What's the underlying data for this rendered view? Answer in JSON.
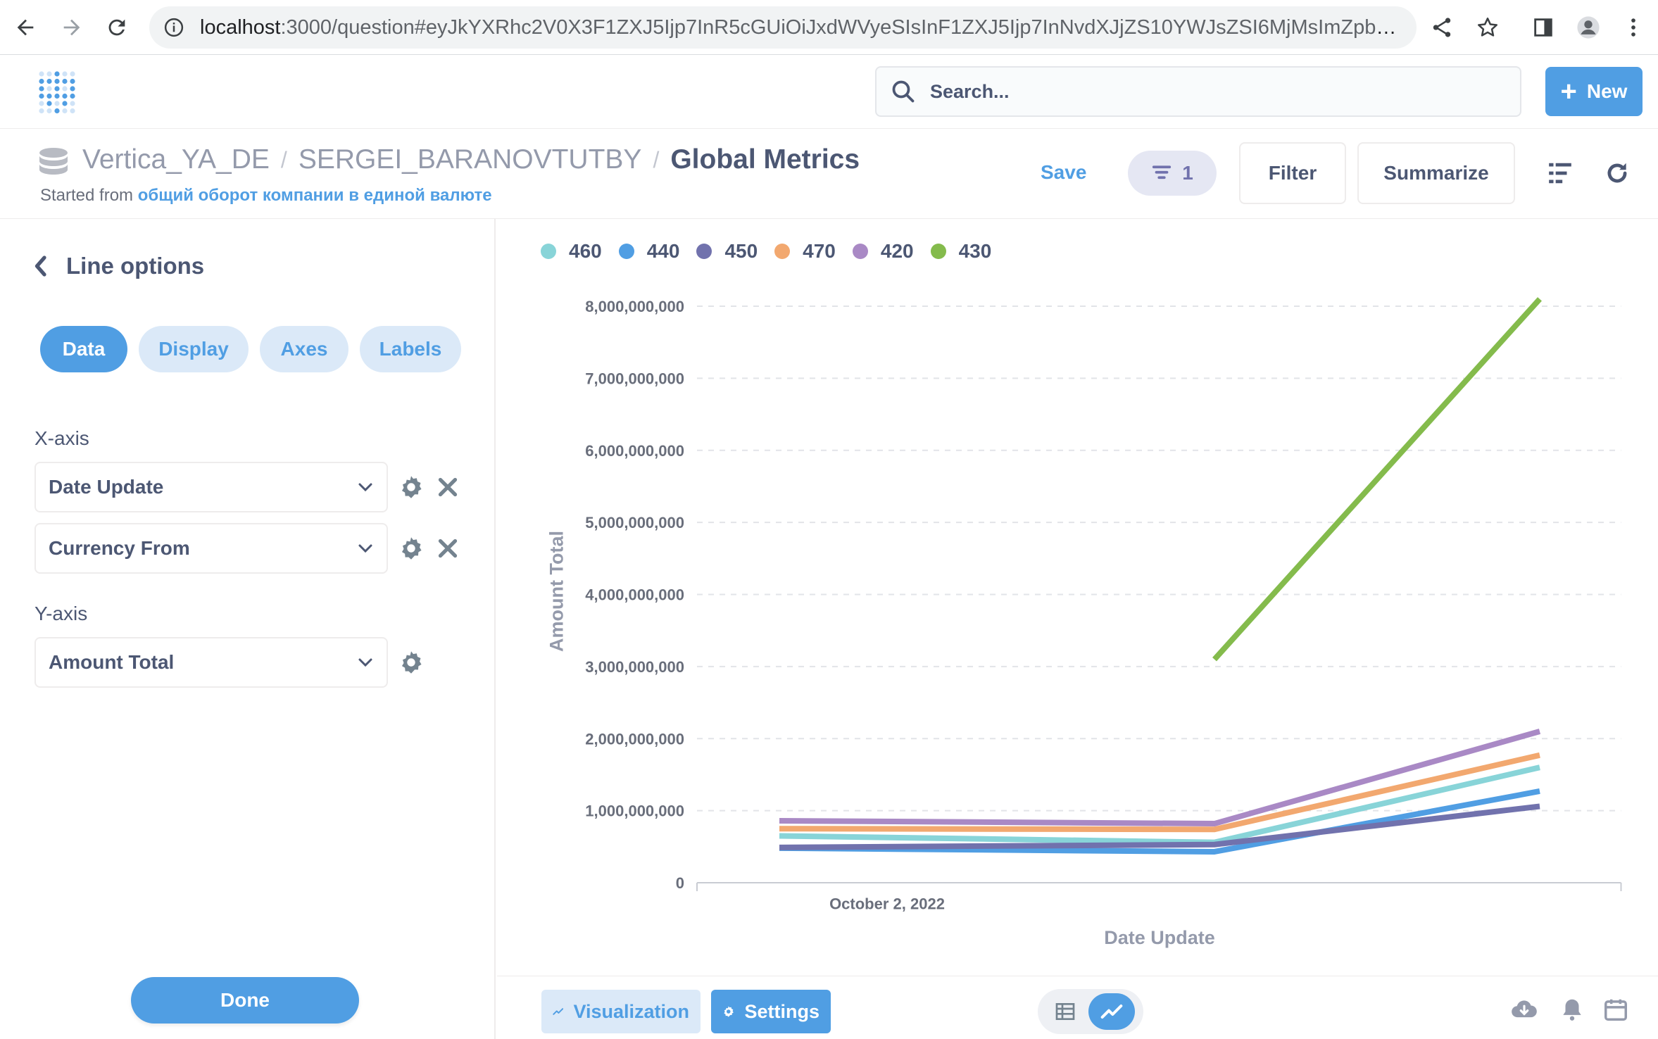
{
  "browser": {
    "url_host": "localhost",
    "url_rest": ":3000/question#eyJkYXRhc2V0X3F1ZXJ5Ijp7InR5cGUiOiJxdWVyeSIsInF1ZXJ5Ijp7InNvdXJjZS10YWJsZSI6MjMsImZpbHRlcil6..."
  },
  "header": {
    "search_placeholder": "Search...",
    "new_label": "New"
  },
  "question": {
    "breadcrumb_db": "Vertica_YA_DE",
    "breadcrumb_schema": "SERGEI_BARANOVTUTBY",
    "breadcrumb_sep": "/",
    "title": "Global Metrics",
    "started_from_prefix": "Started from",
    "started_from_link": "общий оборот компании в единой валюте",
    "save_label": "Save",
    "filter_count": "1",
    "filter_label": "Filter",
    "summarize_label": "Summarize"
  },
  "sidebar": {
    "title": "Line options",
    "tabs": [
      {
        "label": "Data",
        "active": true
      },
      {
        "label": "Display",
        "active": false
      },
      {
        "label": "Axes",
        "active": false
      },
      {
        "label": "Labels",
        "active": false
      }
    ],
    "x_axis_label": "X-axis",
    "x_fields": [
      "Date Update",
      "Currency From"
    ],
    "y_axis_label": "Y-axis",
    "y_fields": [
      "Amount Total"
    ],
    "done_label": "Done"
  },
  "footer": {
    "visualization_label": "Visualization",
    "settings_label": "Settings"
  },
  "colors": {
    "accent": "#509ee3"
  },
  "chart_data": {
    "type": "line",
    "xlabel": "Date Update",
    "ylabel": "Amount Total",
    "x_tick_labels": [
      "October 2, 2022"
    ],
    "y_ticks": [
      0,
      1000000000,
      2000000000,
      3000000000,
      4000000000,
      5000000000,
      6000000000,
      7000000000,
      8000000000
    ],
    "y_tick_labels": [
      "0",
      "1,000,000,000",
      "2,000,000,000",
      "3,000,000,000",
      "4,000,000,000",
      "5,000,000,000",
      "6,000,000,000",
      "7,000,000,000",
      "8,000,000,000"
    ],
    "ylim": [
      0,
      8000000000
    ],
    "grid": "horizontal dashed",
    "legend_position": "top-left",
    "series": [
      {
        "name": "460",
        "color": "#88d4d8",
        "values": [
          650000000,
          560000000,
          1600000000
        ]
      },
      {
        "name": "440",
        "color": "#509ee3",
        "values": [
          480000000,
          430000000,
          1270000000
        ]
      },
      {
        "name": "450",
        "color": "#7172ad",
        "values": [
          490000000,
          530000000,
          1060000000
        ]
      },
      {
        "name": "470",
        "color": "#f2a86f",
        "values": [
          750000000,
          740000000,
          1770000000
        ]
      },
      {
        "name": "420",
        "color": "#a989c5",
        "values": [
          860000000,
          820000000,
          2100000000
        ]
      },
      {
        "name": "430",
        "color": "#84bb4c",
        "values": [
          null,
          3100000000,
          8100000000
        ]
      }
    ]
  }
}
